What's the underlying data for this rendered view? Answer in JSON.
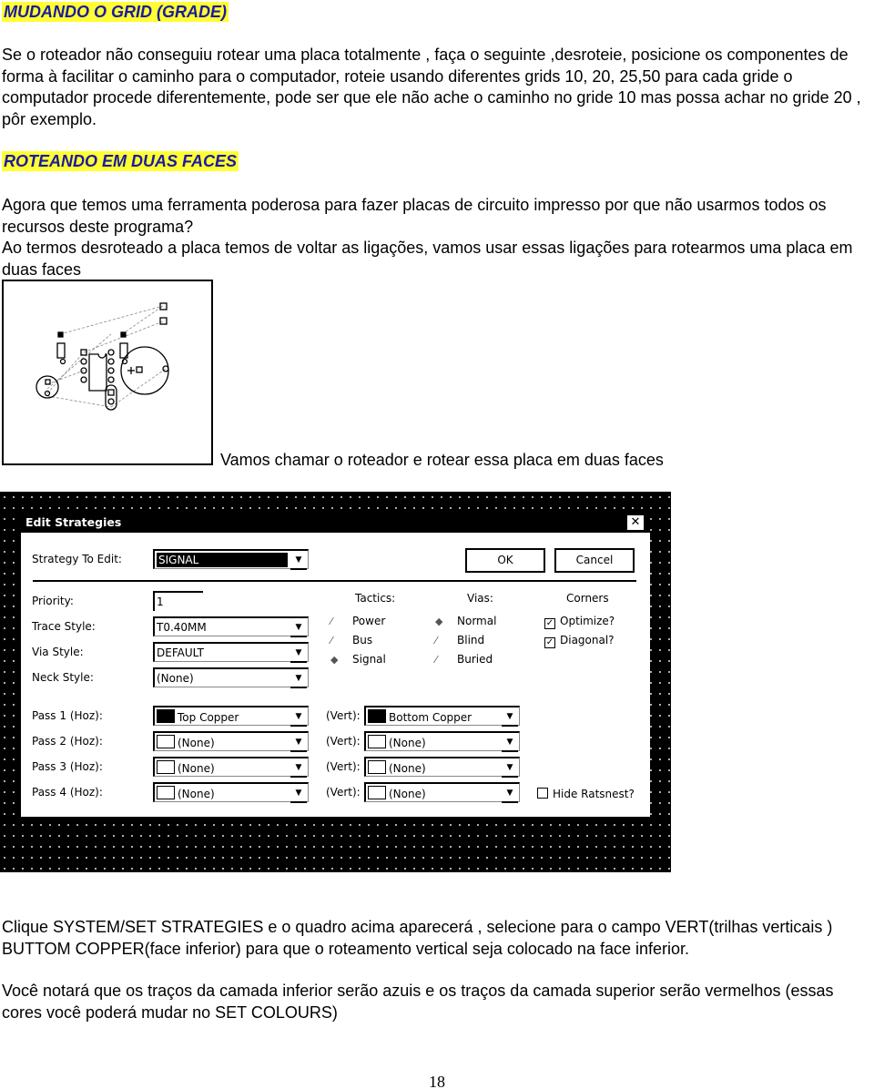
{
  "heading1": "MUDANDO O GRID (GRADE)",
  "para1": "Se o roteador não conseguiu rotear uma placa totalmente , faça o seguinte ,desroteie, posicione os componentes de forma à facilitar o caminho para o computador, roteie usando diferentes grids 10, 20, 25,50 para cada gride o computador procede diferentemente, pode ser que ele não ache  o caminho no gride 10 mas possa achar no gride 20 , pôr exemplo.",
  "heading2": "ROTEANDO EM DUAS FACES",
  "para2": "Agora que temos uma ferramenta poderosa para fazer placas de circuito impresso por que não usarmos todos os recursos deste programa?",
  "para3": "Ao termos desroteado a placa temos de voltar as ligações, vamos usar essas ligações para rotearmos uma placa em duas faces",
  "caption": "Vamos chamar o roteador e rotear essa placa em duas faces",
  "dialog": {
    "title": "Edit Strategies",
    "close": "✕",
    "strategy_label": "Strategy To Edit:",
    "strategy_value": "SIGNAL",
    "ok": "OK",
    "cancel": "Cancel",
    "priority_label": "Priority:",
    "priority_value": "1",
    "trace_label": "Trace Style:",
    "trace_value": "T0.40MM",
    "via_label": "Via Style:",
    "via_value": "DEFAULT",
    "neck_label": "Neck Style:",
    "neck_value": "(None)",
    "tactics_label": "Tactics:",
    "tactics": [
      {
        "label": "Power",
        "selected": false
      },
      {
        "label": "Bus",
        "selected": false
      },
      {
        "label": "Signal",
        "selected": true
      }
    ],
    "vias_label": "Vias:",
    "vias": [
      {
        "label": "Normal",
        "selected": true
      },
      {
        "label": "Blind",
        "selected": false
      },
      {
        "label": "Buried",
        "selected": false
      }
    ],
    "corners_label": "Corners",
    "corners": [
      {
        "label": "Optimize?",
        "checked": true
      },
      {
        "label": "Diagonal?",
        "checked": true
      }
    ],
    "vert_label": "(Vert):",
    "passes": [
      {
        "label": "Pass 1 (Hoz):",
        "hoz": "Top Copper",
        "hoz_filled": true,
        "vert": "Bottom Copper",
        "vert_filled": true
      },
      {
        "label": "Pass 2 (Hoz):",
        "hoz": "(None)",
        "hoz_filled": false,
        "vert": "(None)",
        "vert_filled": false
      },
      {
        "label": "Pass 3 (Hoz):",
        "hoz": "(None)",
        "hoz_filled": false,
        "vert": "(None)",
        "vert_filled": false
      },
      {
        "label": "Pass 4 (Hoz):",
        "hoz": "(None)",
        "hoz_filled": false,
        "vert": "(None)",
        "vert_filled": false
      }
    ],
    "hide_ratsnest": "Hide Ratsnest?",
    "hide_ratsnest_checked": false
  },
  "para4": "Clique SYSTEM/SET STRATEGIES  e o quadro acima aparecerá , selecione para o campo  VERT(trilhas verticais ) BUTTOM COPPER(face inferior) para que o roteamento vertical seja colocado na face inferior.",
  "para5": "Você notará que os traços da camada inferior serão azuis e os traços da camada superior serão vermelhos (essas cores você poderá mudar no SET COLOURS)",
  "page_number": "18"
}
